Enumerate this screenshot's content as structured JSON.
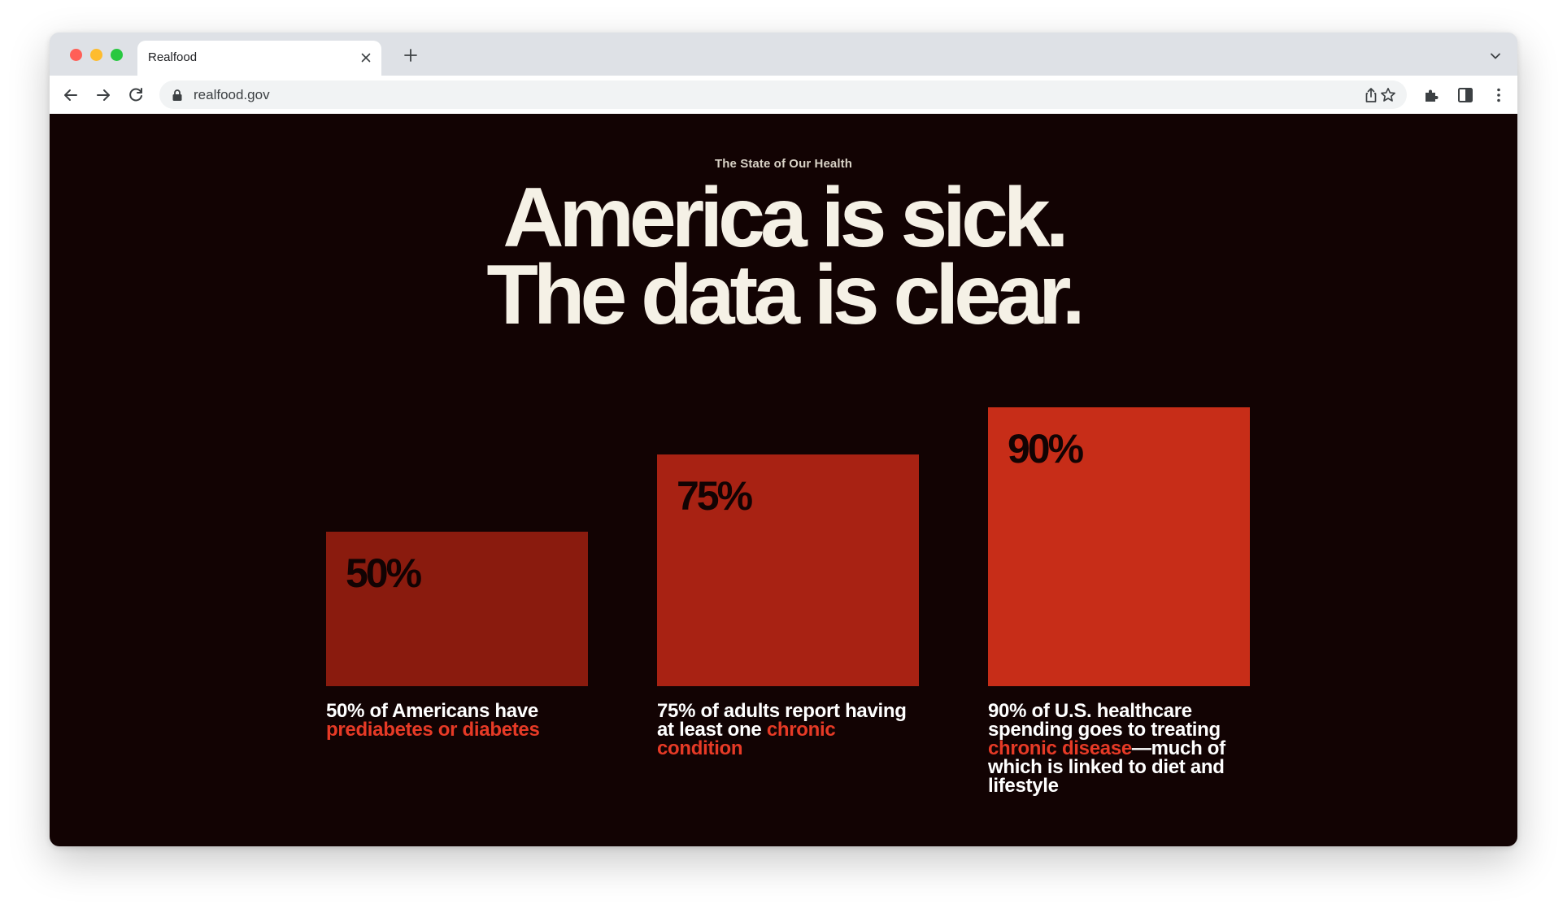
{
  "browser": {
    "tab_title": "Realfood",
    "url": "realfood.gov"
  },
  "page": {
    "eyebrow": "The State of Our Health",
    "headline_line1": "America is sick.",
    "headline_line2": "The data is clear."
  },
  "stats": [
    {
      "value_label": "50%",
      "value": 50,
      "color": "#8a1b0e",
      "caption_pre": "50% of Americans have ",
      "caption_highlight": "prediabetes or diabetes",
      "caption_post": ""
    },
    {
      "value_label": "75%",
      "value": 75,
      "color": "#a82213",
      "caption_pre": "75% of adults report having at least one ",
      "caption_highlight": "chronic condition",
      "caption_post": ""
    },
    {
      "value_label": "90%",
      "value": 90,
      "color": "#c72d18",
      "caption_pre": "90% of U.S. healthcare spending goes to treating ",
      "caption_highlight": "chronic disease",
      "caption_post": "—much of which is linked to diet and lifestyle"
    }
  ],
  "colors": {
    "page_background": "#120303",
    "headline": "#f5f1e6",
    "highlight": "#e63a26"
  }
}
